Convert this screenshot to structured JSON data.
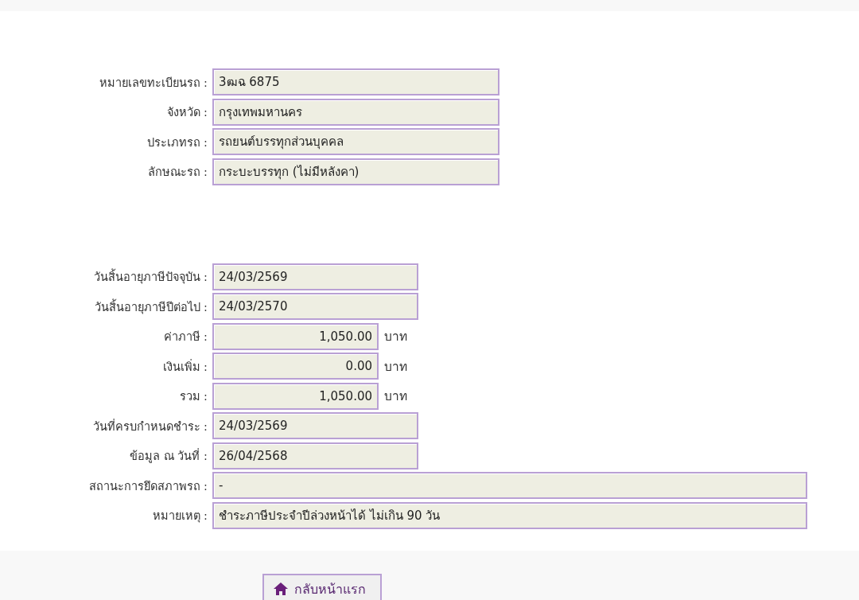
{
  "sections": [
    {
      "rows": [
        {
          "label": "หมายเลขทะเบียนรถ :",
          "value": "3ฒฉ 6875",
          "kind": "text"
        },
        {
          "label": "จังหวัด :",
          "value": "กรุงเทพมหานคร",
          "kind": "text"
        },
        {
          "label": "ประเภทรถ :",
          "value": "รถยนต์บรรทุกส่วนบุคคล",
          "kind": "text"
        },
        {
          "label": "ลักษณะรถ :",
          "value": "กระบะบรรทุก (ไม่มีหลังคา)",
          "kind": "text"
        }
      ]
    },
    {
      "rows": [
        {
          "label": "วันสิ้นอายุภาษีปัจจุบัน :",
          "value": "24/03/2569",
          "kind": "date"
        },
        {
          "label": "วันสิ้นอายุภาษีปีต่อไป :",
          "value": "24/03/2570",
          "kind": "date"
        },
        {
          "label": "ค่าภาษี :",
          "value": "1,050.00",
          "kind": "amount",
          "unit": "บาท"
        },
        {
          "label": "เงินเพิ่ม :",
          "value": "0.00",
          "kind": "amount",
          "unit": "บาท"
        },
        {
          "label": "รวม :",
          "value": "1,050.00",
          "kind": "amount",
          "unit": "บาท"
        },
        {
          "label": "วันที่ครบกำหนดชำระ :",
          "value": "24/03/2569",
          "kind": "date"
        },
        {
          "label": "ข้อมูล ณ วันที่ :",
          "value": "26/04/2568",
          "kind": "date"
        },
        {
          "label": "สถานะการยึดสภาพรถ :",
          "value": "-",
          "kind": "note"
        },
        {
          "label": "หมายเหตุ :",
          "value": "ชำระภาษีประจำปีล่วงหน้าได้ ไม่เกิน 90 วัน",
          "kind": "note"
        }
      ]
    }
  ],
  "footer": {
    "button": "กลับหน้าแรก"
  }
}
